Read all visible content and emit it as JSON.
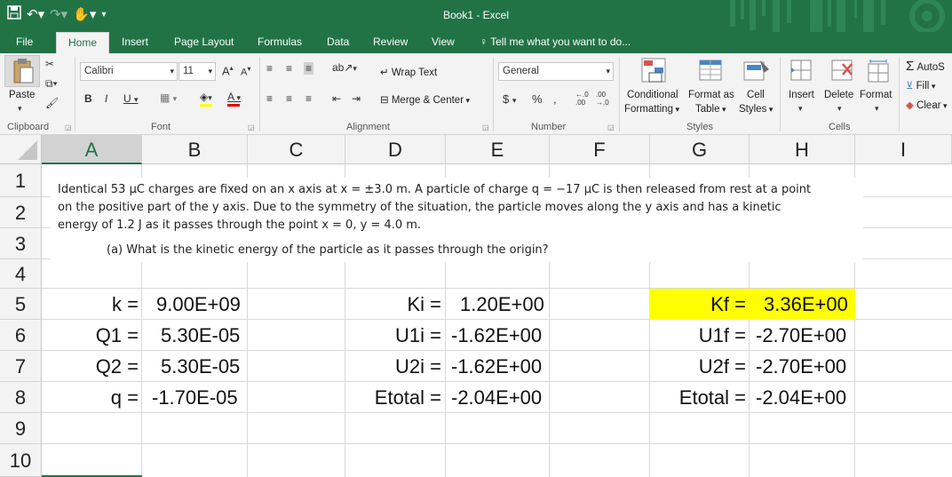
{
  "window": {
    "title": "Book1 - Excel"
  },
  "menu": {
    "tabs": [
      "File",
      "Home",
      "Insert",
      "Page Layout",
      "Formulas",
      "Data",
      "Review",
      "View"
    ],
    "tell_me": "Tell me what you want to do..."
  },
  "ribbon": {
    "font_name": "Calibri",
    "font_size": "11",
    "wrap_text": "Wrap Text",
    "merge_center": "Merge & Center",
    "number_format": "General",
    "paste": "Paste",
    "conditional_formatting_1": "Conditional",
    "conditional_formatting_2": "Formatting",
    "format_as_table_1": "Format as",
    "format_as_table_2": "Table",
    "cell_styles_1": "Cell",
    "cell_styles_2": "Styles",
    "insert": "Insert",
    "delete": "Delete",
    "format": "Format",
    "autosum": "AutoS",
    "fill": "Fill",
    "clear": "Clear",
    "groups": {
      "clipboard": "Clipboard",
      "font": "Font",
      "alignment": "Alignment",
      "number": "Number",
      "styles": "Styles",
      "cells": "Cells"
    }
  },
  "sheet": {
    "columns": [
      "A",
      "B",
      "C",
      "D",
      "E",
      "F",
      "G",
      "H",
      "I"
    ],
    "rows": [
      "1",
      "2",
      "3",
      "4",
      "5",
      "6",
      "7",
      "8",
      "9",
      "10"
    ],
    "problem_line1": "Identical 53 μC charges are fixed on an x axis at x = ±3.0 m. A particle of charge q = −17 μC is then released from rest at a point",
    "problem_line2": "on the positive part of the y axis. Due to the symmetry of the situation, the particle moves along the y axis and has a kinetic",
    "problem_line3": "energy of 1.2 J as it passes through the point x = 0, y = 4.0 m.",
    "problem_question": "(a) What is the kinetic energy of the particle as it passes through the origin?",
    "rows_data": [
      {
        "a": "k =",
        "b": "9.00E+09",
        "d": "Ki =",
        "e": "1.20E+00",
        "g": "Kf =",
        "h": "3.36E+00"
      },
      {
        "a": "Q1 =",
        "b": "5.30E-05",
        "d": "U1i =",
        "e": "-1.62E+00",
        "g": "U1f =",
        "h": "-2.70E+00"
      },
      {
        "a": "Q2 =",
        "b": "5.30E-05",
        "d": "U2i =",
        "e": "-1.62E+00",
        "g": "U2f =",
        "h": "-2.70E+00"
      },
      {
        "a": "q =",
        "b": "-1.70E-05",
        "d": "Etotal =",
        "e": "-2.04E+00",
        "g": "Etotal =",
        "h": "-2.04E+00"
      }
    ],
    "highlight_color": "#ffff00"
  },
  "colors": {
    "excel_green": "#217346"
  }
}
